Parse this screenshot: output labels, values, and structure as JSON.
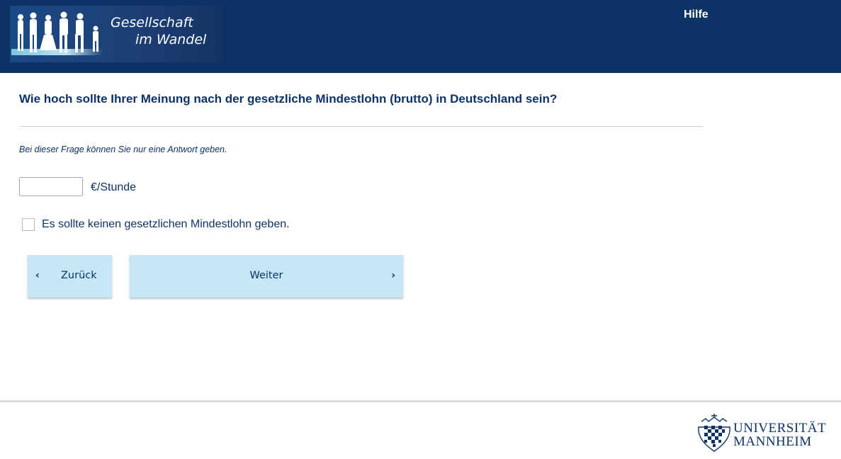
{
  "header": {
    "logo_line1": "Gesellschaft",
    "logo_line2": "im Wandel",
    "help_label": "Hilfe"
  },
  "question": {
    "text": "Wie hoch sollte Ihrer Meinung nach der gesetzliche Mindestlohn (brutto) in Deutschland sein?",
    "hint": "Bei dieser Frage können Sie nur eine Antwort geben.",
    "input_value": "",
    "unit": "€/Stunde",
    "checkbox_label": "Es sollte keinen gesetzlichen Mindestlohn geben.",
    "checkbox_checked": false
  },
  "nav": {
    "back_label": "Zurück",
    "next_label": "Weiter",
    "back_icon": "chevron-left-icon",
    "next_icon": "chevron-right-icon"
  },
  "footer": {
    "uni_line1": "UNIVERSITÄT",
    "uni_line2": "MANNHEIM"
  },
  "colors": {
    "header_bg": "#0d3266",
    "text_primary": "#0d3266",
    "button_bg": "#c6e8f6"
  }
}
